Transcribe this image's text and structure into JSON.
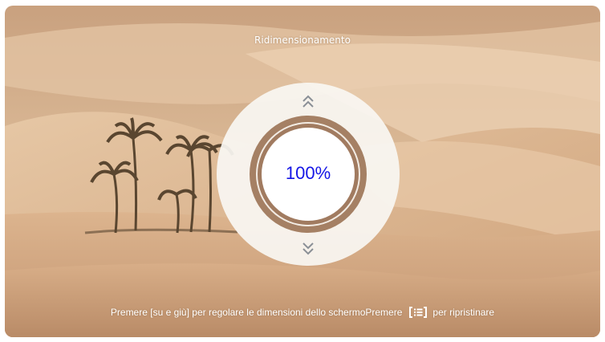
{
  "dialog": {
    "title": "Ridimensionamento",
    "zoom_value": "100%",
    "up_icon": "double-chevron-up-icon",
    "down_icon": "double-chevron-down-icon"
  },
  "hint": {
    "part1": "Premere [su e giù] per regolare le dimensioni dello schermoPremere",
    "key_icon": "menu-key-icon",
    "part2": "per ripristinare"
  },
  "colors": {
    "value_text": "#1515e6",
    "ring": "#a58064",
    "dial_bg": "#f9f6f2",
    "sand": "#d9b28c"
  }
}
